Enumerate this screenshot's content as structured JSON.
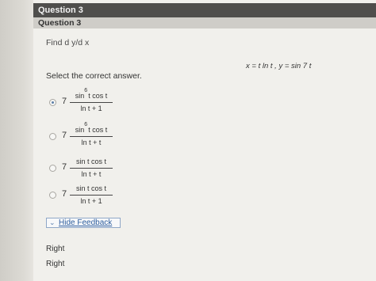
{
  "header": {
    "title": "Question 3",
    "subtitle": "Question 3"
  },
  "question": {
    "prompt": "Find d y/d x",
    "given": "x = t ln t , y = sin 7 t",
    "instruction": "Select the correct answer."
  },
  "options": [
    {
      "coef": "7",
      "numerator": "sin",
      "exponent": "6",
      "numerator_rest": "t cos t",
      "denominator": "ln t + 1",
      "selected": true
    },
    {
      "coef": "7",
      "numerator": "sin",
      "exponent": "6",
      "numerator_rest": "t cos t",
      "denominator": "ln t + t",
      "selected": false
    },
    {
      "coef": "7",
      "numerator": "sin t cos t",
      "exponent": "",
      "numerator_rest": "",
      "denominator": "ln t + t",
      "selected": false
    },
    {
      "coef": "7",
      "numerator": "sin t cos t",
      "exponent": "",
      "numerator_rest": "",
      "denominator": "ln t + 1",
      "selected": false
    }
  ],
  "feedback": {
    "toggle_label": "Hide Feedback"
  },
  "results": [
    "Right",
    "Right"
  ]
}
